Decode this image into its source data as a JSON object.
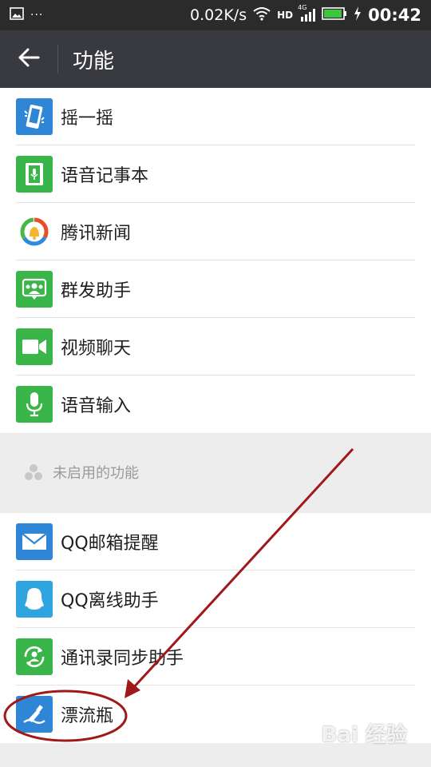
{
  "status_bar": {
    "left_icons": [
      "image-icon",
      "more-icon"
    ],
    "speed": "0.02K/s",
    "hd": "HD",
    "network": "4G",
    "time": "00:42"
  },
  "header": {
    "title": "功能"
  },
  "enabled_features": [
    {
      "label": "摇一摇",
      "icon": "shake-icon",
      "color": "#2f86d6"
    },
    {
      "label": "语音记事本",
      "icon": "voice-notepad-icon",
      "color": "#39b54a"
    },
    {
      "label": "腾讯新闻",
      "icon": "tencent-news-icon",
      "color": "#ffffff"
    },
    {
      "label": "群发助手",
      "icon": "mass-send-icon",
      "color": "#39b54a"
    },
    {
      "label": "视频聊天",
      "icon": "video-chat-icon",
      "color": "#39b54a"
    },
    {
      "label": "语音输入",
      "icon": "microphone-icon",
      "color": "#39b54a"
    }
  ],
  "disabled_section": {
    "title": "未启用的功能"
  },
  "disabled_features": [
    {
      "label": "QQ邮箱提醒",
      "icon": "mail-icon",
      "color": "#2f86d6"
    },
    {
      "label": "QQ离线助手",
      "icon": "qq-penguin-icon",
      "color": "#2fa5e0"
    },
    {
      "label": "通讯录同步助手",
      "icon": "contact-sync-icon",
      "color": "#39b54a"
    },
    {
      "label": "漂流瓶",
      "icon": "drift-bottle-icon",
      "color": "#2f86d6"
    }
  ],
  "watermark": "Bai 经验",
  "annotation_color": "#a01818"
}
